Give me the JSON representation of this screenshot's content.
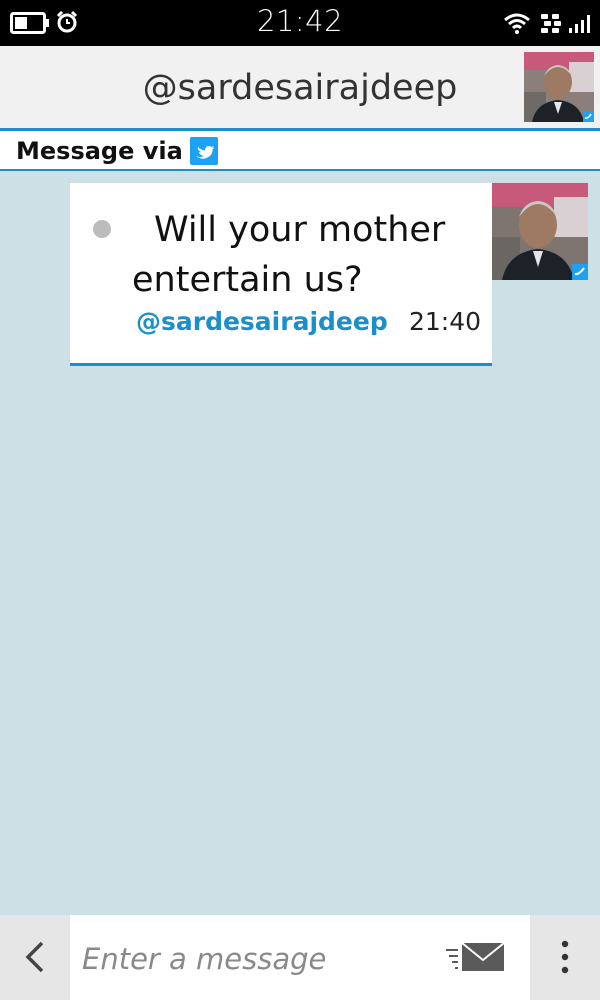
{
  "status_bar": {
    "time": "21:42",
    "icons": [
      "battery-icon",
      "alarm-icon",
      "wifi-icon",
      "bbm-icon",
      "signal-icon"
    ]
  },
  "header": {
    "title": "@sardesairajdeep",
    "avatar": "profile-avatar"
  },
  "via_bar": {
    "label": "Message via",
    "icon": "twitter-icon"
  },
  "message": {
    "text": "Will your mother entertain us?",
    "sender": "@sardesairajdeep",
    "time": "21:40",
    "status": "unread"
  },
  "compose": {
    "placeholder": "Enter a message",
    "value": "",
    "icons": [
      "back-icon",
      "send-icon",
      "more-icon"
    ]
  },
  "colors": {
    "accent": "#1a8fc9",
    "background": "#cce0e6",
    "status_bar": "#000000",
    "header": "#f1f1f1",
    "compose_bar": "#e6e6e6"
  }
}
